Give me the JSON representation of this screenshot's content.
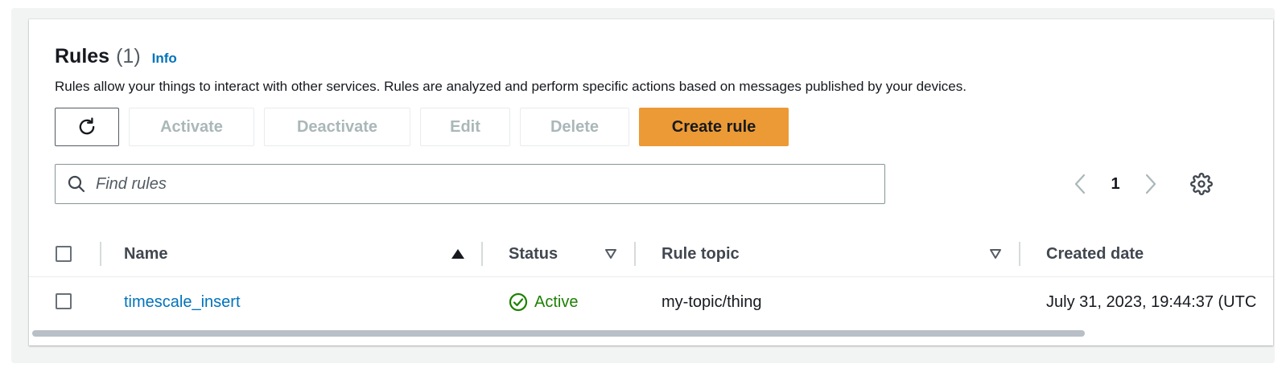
{
  "header": {
    "title": "Rules",
    "count": "(1)",
    "info_label": "Info",
    "description": "Rules allow your things to interact with other services. Rules are analyzed and perform specific actions based on messages published by your devices."
  },
  "actions": {
    "activate_label": "Activate",
    "deactivate_label": "Deactivate",
    "edit_label": "Edit",
    "delete_label": "Delete",
    "create_label": "Create rule",
    "primary_color": "#ec9a35"
  },
  "search": {
    "placeholder": "Find rules"
  },
  "pagination": {
    "current_page": "1"
  },
  "table": {
    "columns": {
      "name": "Name",
      "status": "Status",
      "rule_topic": "Rule topic",
      "created_date": "Created date"
    },
    "sorted_column": "Name",
    "rows": [
      {
        "name": "timescale_insert",
        "status": "Active",
        "rule_topic": "my-topic/thing",
        "created_date": "July 31, 2023, 19:44:37 (UTC"
      }
    ]
  },
  "icons": {
    "refresh": "refresh-icon",
    "search": "search-icon",
    "prev": "chevron-left-icon",
    "next": "chevron-right-icon",
    "settings": "gear-icon",
    "sort_asc": "sort-ascending-icon",
    "sort_none": "sort-descending-outline-icon",
    "status": "check-circle-icon"
  },
  "colors": {
    "link": "#0073bb",
    "status_active": "#1d8102"
  }
}
